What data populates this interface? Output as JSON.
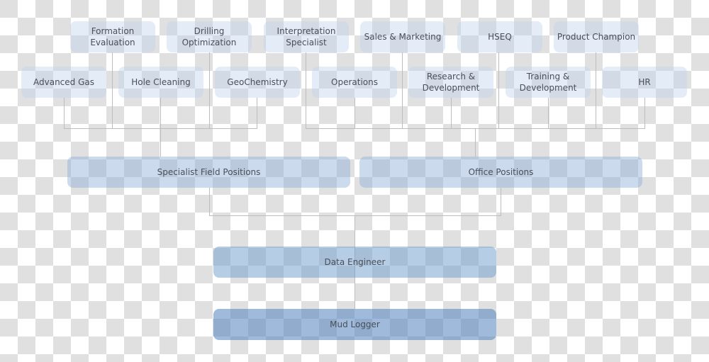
{
  "diagram": {
    "type": "org-chart",
    "departments_top": [
      {
        "id": "formation-evaluation",
        "label": "Formation\nEvaluation"
      },
      {
        "id": "drilling-optimization",
        "label": "Drilling\nOptimization"
      },
      {
        "id": "interpretation-specialist",
        "label": "Interpretation\nSpecialist"
      },
      {
        "id": "sales-marketing",
        "label": "Sales & Marketing"
      },
      {
        "id": "hseq",
        "label": "HSEQ"
      },
      {
        "id": "product-champion",
        "label": "Product Champion"
      }
    ],
    "departments_second": [
      {
        "id": "advanced-gas",
        "label": "Advanced Gas"
      },
      {
        "id": "hole-cleaning",
        "label": "Hole Cleaning"
      },
      {
        "id": "geochemistry",
        "label": "GeoChemistry"
      },
      {
        "id": "operations",
        "label": "Operations"
      },
      {
        "id": "research-development",
        "label": "Research &\nDevelopment"
      },
      {
        "id": "training-development",
        "label": "Training &\nDevelopment"
      },
      {
        "id": "hr",
        "label": "HR"
      }
    ],
    "groups": [
      {
        "id": "specialist-field-positions",
        "label": "Specialist Field Positions",
        "children": [
          "formation-evaluation",
          "drilling-optimization",
          "advanced-gas",
          "hole-cleaning",
          "geochemistry"
        ]
      },
      {
        "id": "office-positions",
        "label": "Office Positions",
        "children": [
          "interpretation-specialist",
          "sales-marketing",
          "hseq",
          "product-champion",
          "operations",
          "research-development",
          "training-development",
          "hr"
        ]
      }
    ],
    "data_engineer": {
      "label": "Data Engineer"
    },
    "mud_logger": {
      "label": "Mud Logger"
    }
  }
}
